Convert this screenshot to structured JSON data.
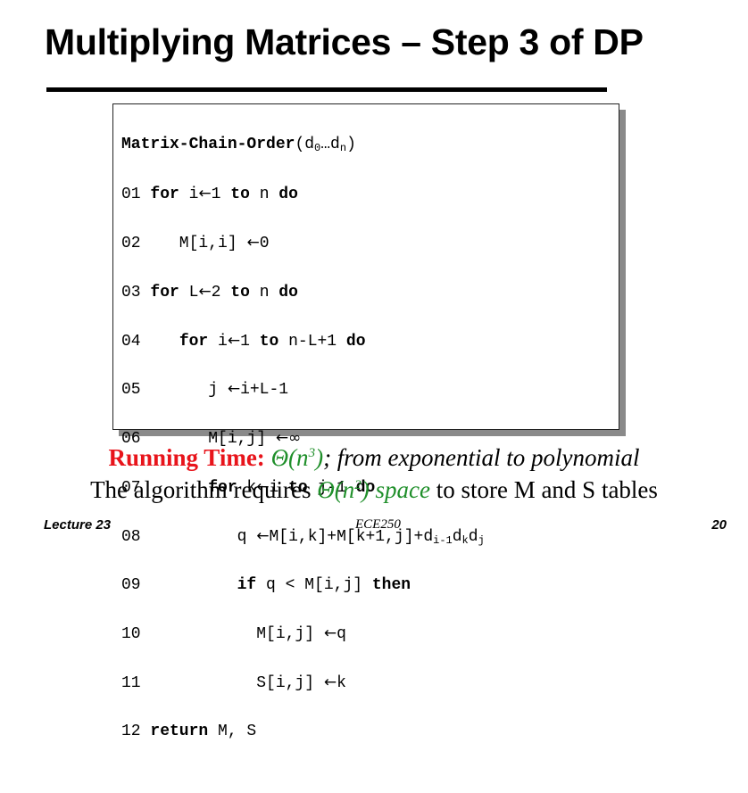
{
  "slide": {
    "title": "Multiplying Matrices – Step 3 of DP"
  },
  "code": {
    "header_name": "Matrix-Chain-Order",
    "header_args": "(d₀…dₙ)",
    "lines": [
      {
        "num": "01",
        "text": "for i←1 to n do"
      },
      {
        "num": "02",
        "text": "M[i,i] ←0"
      },
      {
        "num": "03",
        "text": "for L←2 to n do"
      },
      {
        "num": "04",
        "text": "for i←1 to n-L+1 do"
      },
      {
        "num": "05",
        "text": "j ←i+L-1"
      },
      {
        "num": "06",
        "text": "M[i,j] ←∞"
      },
      {
        "num": "07",
        "text": "for k←i to j-1 do"
      },
      {
        "num": "08",
        "text": "q ←M[i,k]+M[k+1,j]+dᵢ₋₁dₖdⱼ"
      },
      {
        "num": "09",
        "text": "if q < M[i,j] then"
      },
      {
        "num": "10",
        "text": "M[i,j] ←q"
      },
      {
        "num": "11",
        "text": "S[i,j] ←k"
      },
      {
        "num": "12",
        "text": "return M, S"
      }
    ]
  },
  "running_time": {
    "label": "Running Time:",
    "complexity": "Θ(n³)",
    "comment": "; from exponential to polynomial"
  },
  "space_note": {
    "prefix": "The algorithm requires ",
    "space": "Θ(n²) space",
    "suffix": " to store M and S tables"
  },
  "footer": {
    "lecture": "Lecture 23",
    "course": "ECE250",
    "page": "20"
  },
  "colors": {
    "red": "#e8141b",
    "green": "#1f8f2a"
  }
}
